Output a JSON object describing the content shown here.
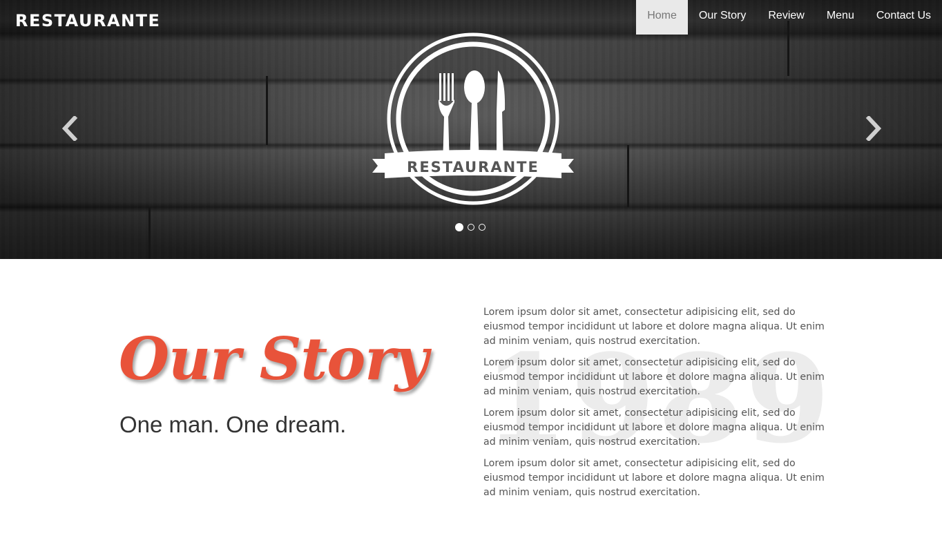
{
  "brand": {
    "name": "RESTAURANTE"
  },
  "nav": {
    "items": [
      "Home",
      "Our Story",
      "Review",
      "Menu",
      "Contact Us"
    ],
    "active": "Home"
  },
  "hero": {
    "logo_text": "RESTAURANTE",
    "slides_total": 3,
    "active_slide": 1,
    "prev_icon": "chevron-left-icon",
    "next_icon": "chevron-right-icon"
  },
  "story": {
    "title": "Our Story",
    "subtitle": "One man. One dream.",
    "year": "1989",
    "paragraphs": [
      "Lorem ipsum dolor sit amet, consectetur adipisicing elit, sed do eiusmod tempor incididunt ut labore et dolore magna aliqua. Ut enim ad minim veniam, quis nostrud exercitation.",
      "Lorem ipsum dolor sit amet, consectetur adipisicing elit, sed do eiusmod tempor incididunt ut labore et dolore magna aliqua. Ut enim ad minim veniam, quis nostrud exercitation.",
      "Lorem ipsum dolor sit amet, consectetur adipisicing elit, sed do eiusmod tempor incididunt ut labore et dolore magna aliqua. Ut enim ad minim veniam, quis nostrud exercitation.",
      "Lorem ipsum dolor sit amet, consectetur adipisicing elit, sed do eiusmod tempor incididunt ut labore et dolore magna aliqua. Ut enim ad minim veniam, quis nostrud exercitation."
    ]
  },
  "colors": {
    "accent": "#e8533a",
    "nav_active_bg": "#e9e9e9",
    "text": "#555555"
  }
}
